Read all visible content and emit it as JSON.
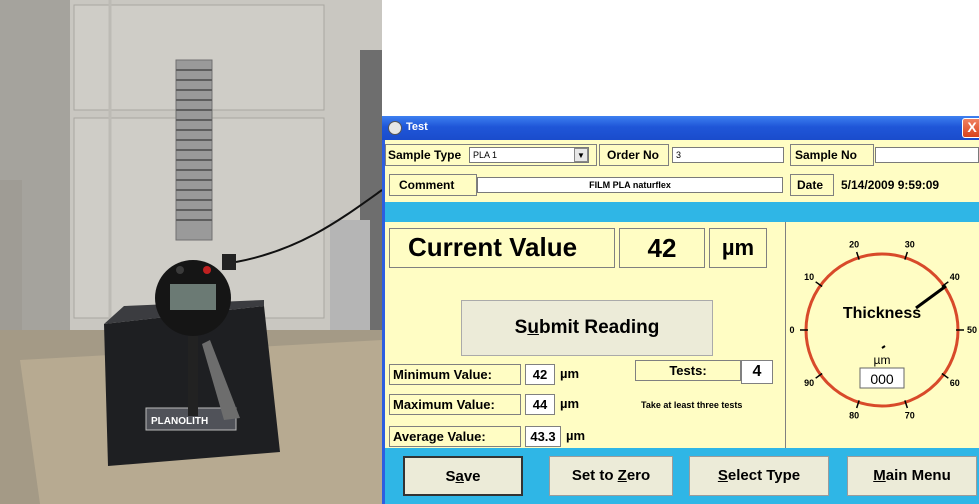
{
  "window": {
    "title": "Test",
    "close_glyph": "X"
  },
  "header": {
    "sample_type_label": "Sample Type",
    "sample_type_value": "PLA 1",
    "order_no_label": "Order No",
    "order_no_value": "3",
    "sample_no_label": "Sample No",
    "sample_no_value": "",
    "comment_label": "Comment",
    "comment_value": "FILM PLA naturflex",
    "date_label": "Date",
    "date_value": "5/14/2009 9:59:09"
  },
  "current": {
    "label": "Current Value",
    "value": "42",
    "unit": "µm"
  },
  "submit": {
    "label_pre": "S",
    "label_u": "u",
    "label_post": "bmit Reading"
  },
  "stats": {
    "min_label": "Minimum Value:",
    "min_value": "42",
    "min_unit": "µm",
    "max_label": "Maximum Value:",
    "max_value": "44",
    "max_unit": "µm",
    "avg_label": "Average Value:",
    "avg_value": "43.3",
    "avg_unit": "µm",
    "tests_label": "Tests:",
    "tests_value": "4",
    "hint": "Take at least three tests"
  },
  "gauge": {
    "title": "Thickness",
    "unit": "µm",
    "readout": "000",
    "ticks": [
      "0",
      "10",
      "20",
      "30",
      "40",
      "50",
      "60",
      "70",
      "80",
      "90"
    ]
  },
  "actions": [
    {
      "pre": "S",
      "u": "a",
      "post": "ve"
    },
    {
      "pre": "Set to ",
      "u": "Z",
      "post": "ero"
    },
    {
      "pre": "",
      "u": "S",
      "post": "elect Type"
    },
    {
      "pre": "",
      "u": "M",
      "post": "ain Menu"
    }
  ],
  "colors": {
    "window_blue": "#1f56d8",
    "panel_yellow": "#fffdc4",
    "band_cyan": "#2fb6e6",
    "gauge_red": "#d84a2a",
    "button_face": "#ecebd8"
  }
}
